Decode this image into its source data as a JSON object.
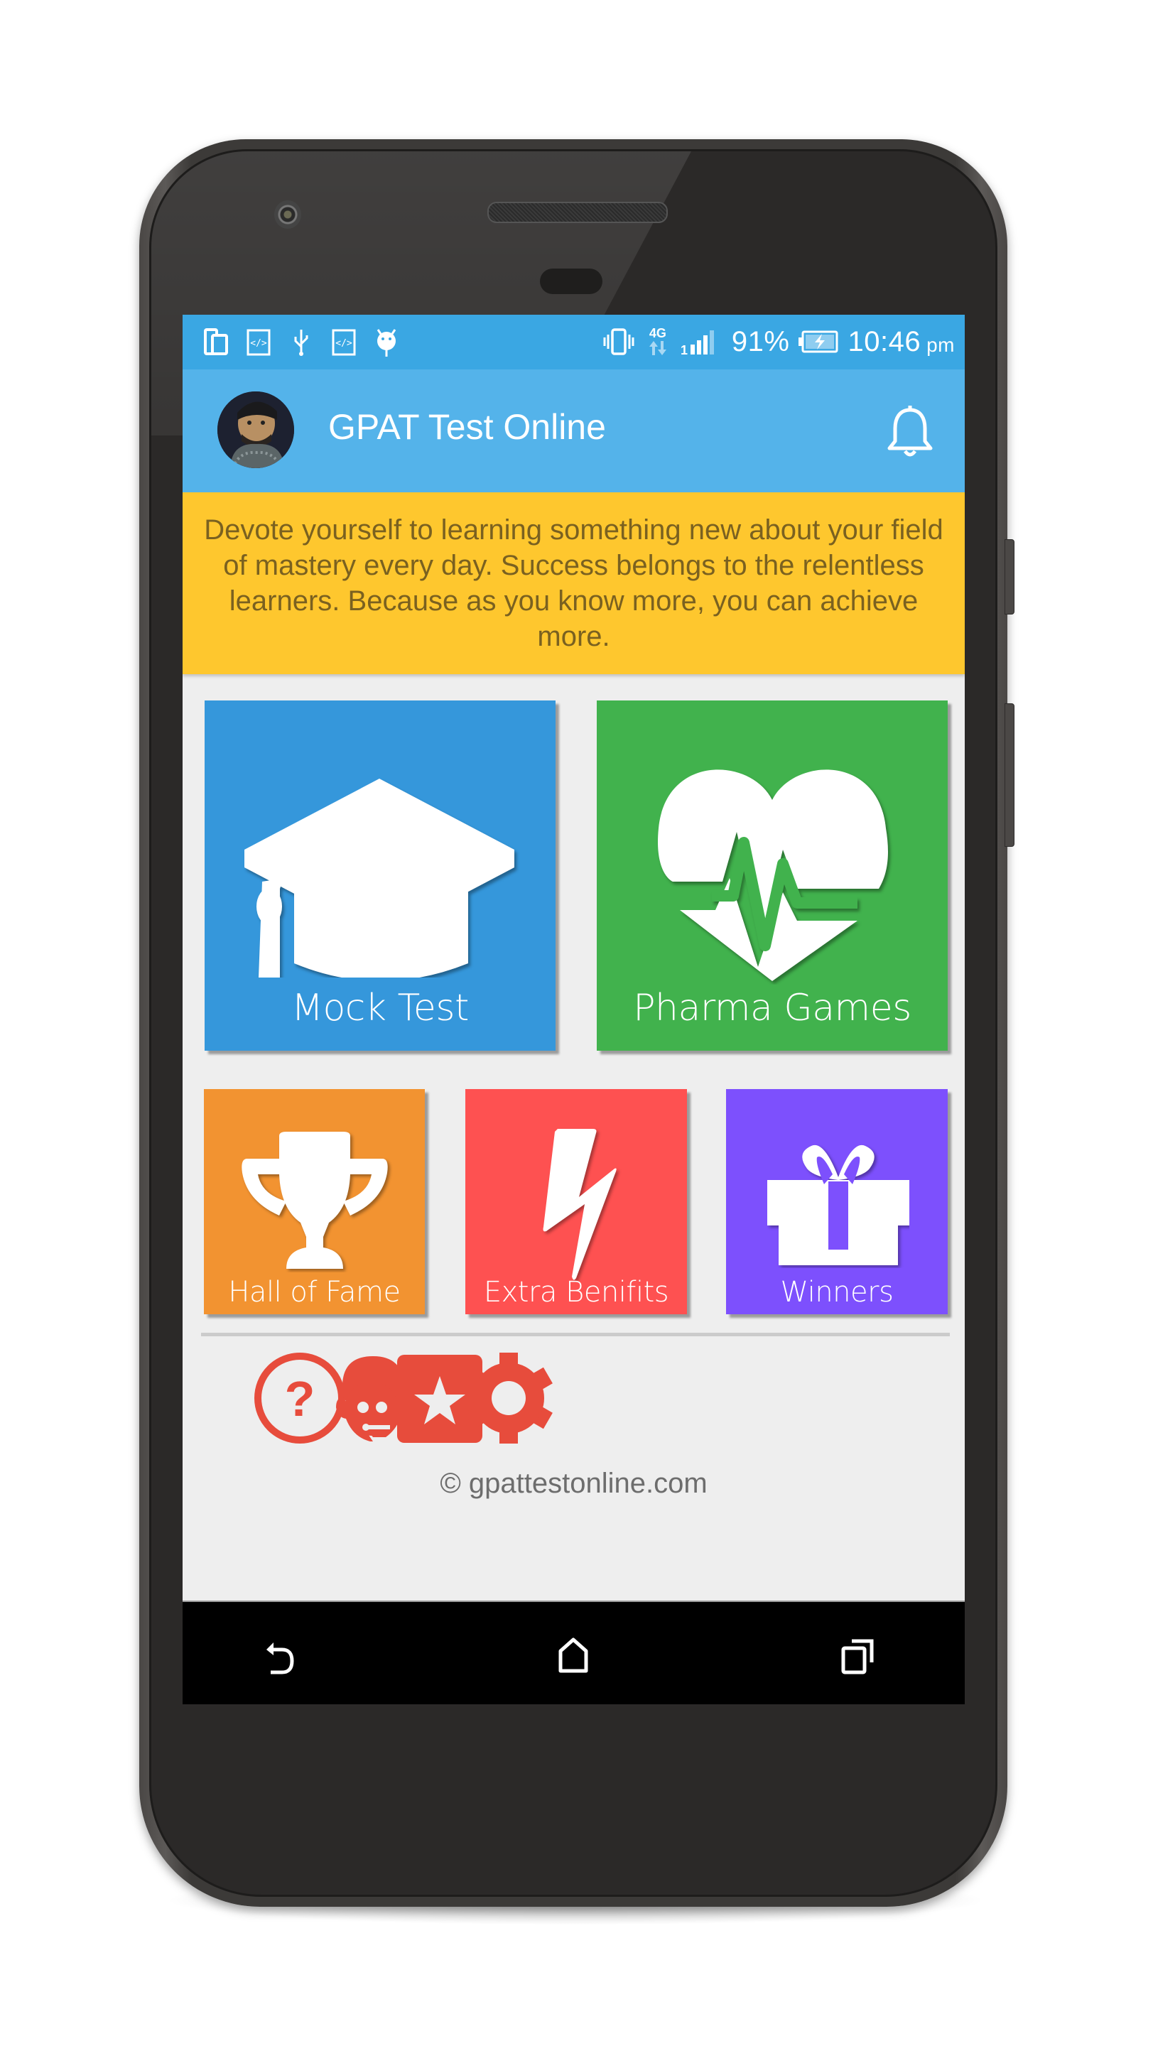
{
  "status_bar": {
    "left_icons": [
      "screen-mirror-icon",
      "code-icon",
      "usb-icon",
      "code-icon",
      "android-debug-icon"
    ],
    "right_icons": [
      "vibrate-icon",
      "4g-data-icon",
      "signal-icon",
      "battery-charging-icon"
    ],
    "network_label": "4G",
    "battery_percent": "91%",
    "time": "10:46",
    "ampm": "pm"
  },
  "app_bar": {
    "title": "GPAT Test Online",
    "avatar": "user-avatar",
    "notification_icon": "bell-icon"
  },
  "banner": {
    "quote": "Devote yourself to learning something new about your field of mastery every day. Success belongs to the relentless learners. Because as you know more, you can achieve more."
  },
  "tiles": [
    {
      "label": "Mock Test",
      "icon": "graduation-cap-icon",
      "color": "#3597db"
    },
    {
      "label": "Pharma Games",
      "icon": "heartbeat-icon",
      "color": "#41b24d"
    },
    {
      "label": "Hall of Fame",
      "icon": "trophy-icon",
      "color": "#f29331"
    },
    {
      "label": "Extra Benifits",
      "icon": "lightning-icon",
      "color": "#fe5151"
    },
    {
      "label": "Winners",
      "icon": "gift-icon",
      "color": "#7d50fd"
    }
  ],
  "utility_icons": [
    {
      "name": "help",
      "icon": "help-circle-icon"
    },
    {
      "name": "support",
      "icon": "support-agent-icon"
    },
    {
      "name": "rate",
      "icon": "star-box-icon"
    },
    {
      "name": "settings",
      "icon": "gear-icon"
    }
  ],
  "accent_color": "#e74c3c",
  "footer": {
    "copyright": "© gpattestonline.com"
  },
  "nav_bar": {
    "buttons": [
      "back-icon",
      "home-icon",
      "recents-icon"
    ]
  }
}
